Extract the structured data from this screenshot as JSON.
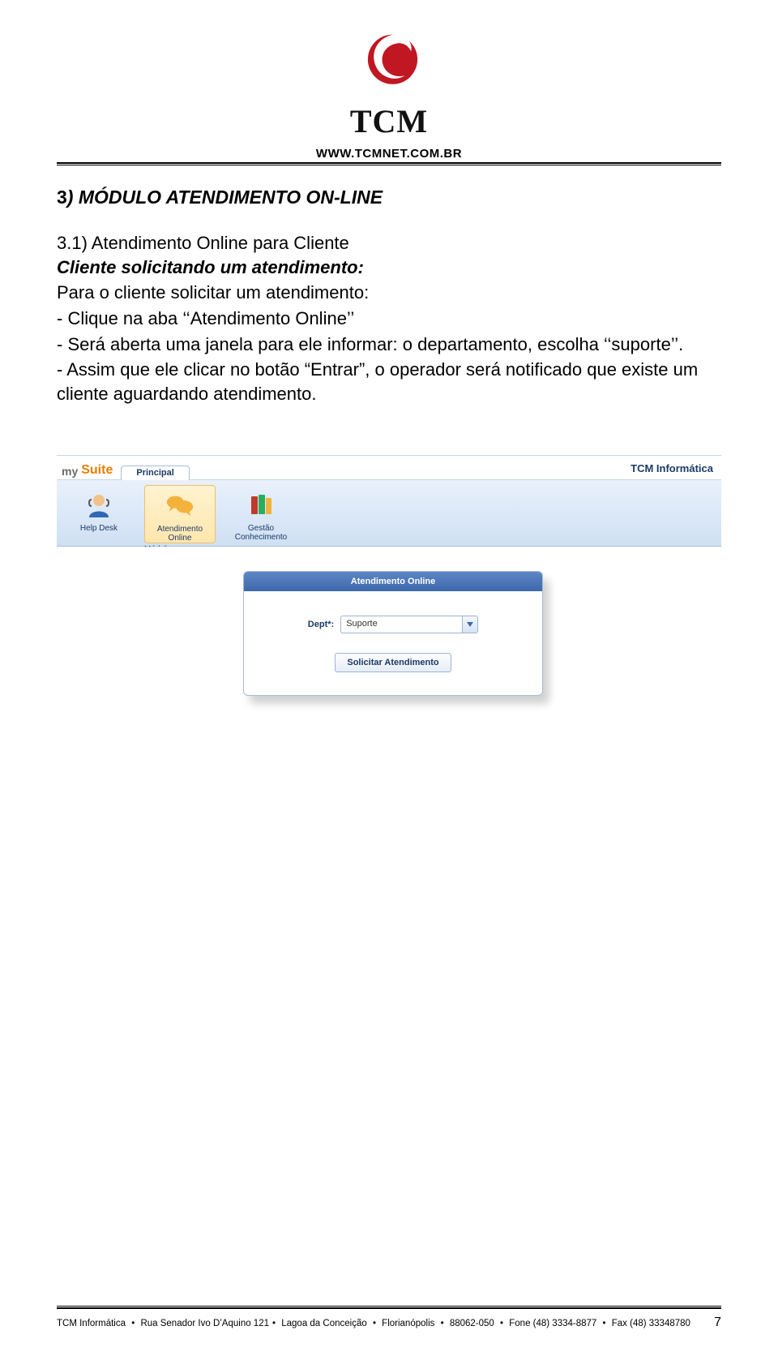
{
  "header": {
    "logo_text": "TCM",
    "url": "WWW.TCMNET.COM.BR"
  },
  "section": {
    "title_num": "3",
    "title_rest": ") MÓDULO ATENDIMENTO ON-LINE",
    "sub_lead": "3.1) Atendimento Online para Cliente",
    "sub_italic": "Cliente solicitando um atendimento:",
    "para1": "Para o cliente solicitar um atendimento:",
    "bullet1": "- Clique na aba ‘‘Atendimento Online’’",
    "bullet2": "- Será aberta uma janela para ele informar: o departamento, escolha ‘‘suporte’’.",
    "bullet3": "- Assim que ele clicar no botão “Entrar”, o operador será notificado que existe um cliente aguardando atendimento."
  },
  "screenshot": {
    "brand_my": "my",
    "brand_suite": "Suite",
    "tab_principal": "Principal",
    "right_brand": "TCM Informática",
    "ribbon": {
      "helpdesk": "Help Desk",
      "atendimento": "Atendimento Online",
      "gestao": "Gestão Conhecimento",
      "group_label": "Módulos"
    },
    "panel": {
      "title": "Atendimento Online",
      "field_label": "Dept*:",
      "field_value": "Suporte",
      "submit": "Solicitar Atendimento"
    }
  },
  "footer": {
    "company": "TCM Informática",
    "addr1": "Rua Senador Ivo D’Aquino 121",
    "addr2": "Lagoa da Conceição",
    "city": "Florianópolis",
    "zip": "88062-050",
    "phone": "Fone (48) 3334-8877",
    "fax": "Fax (48) 33348780",
    "page": "7"
  }
}
